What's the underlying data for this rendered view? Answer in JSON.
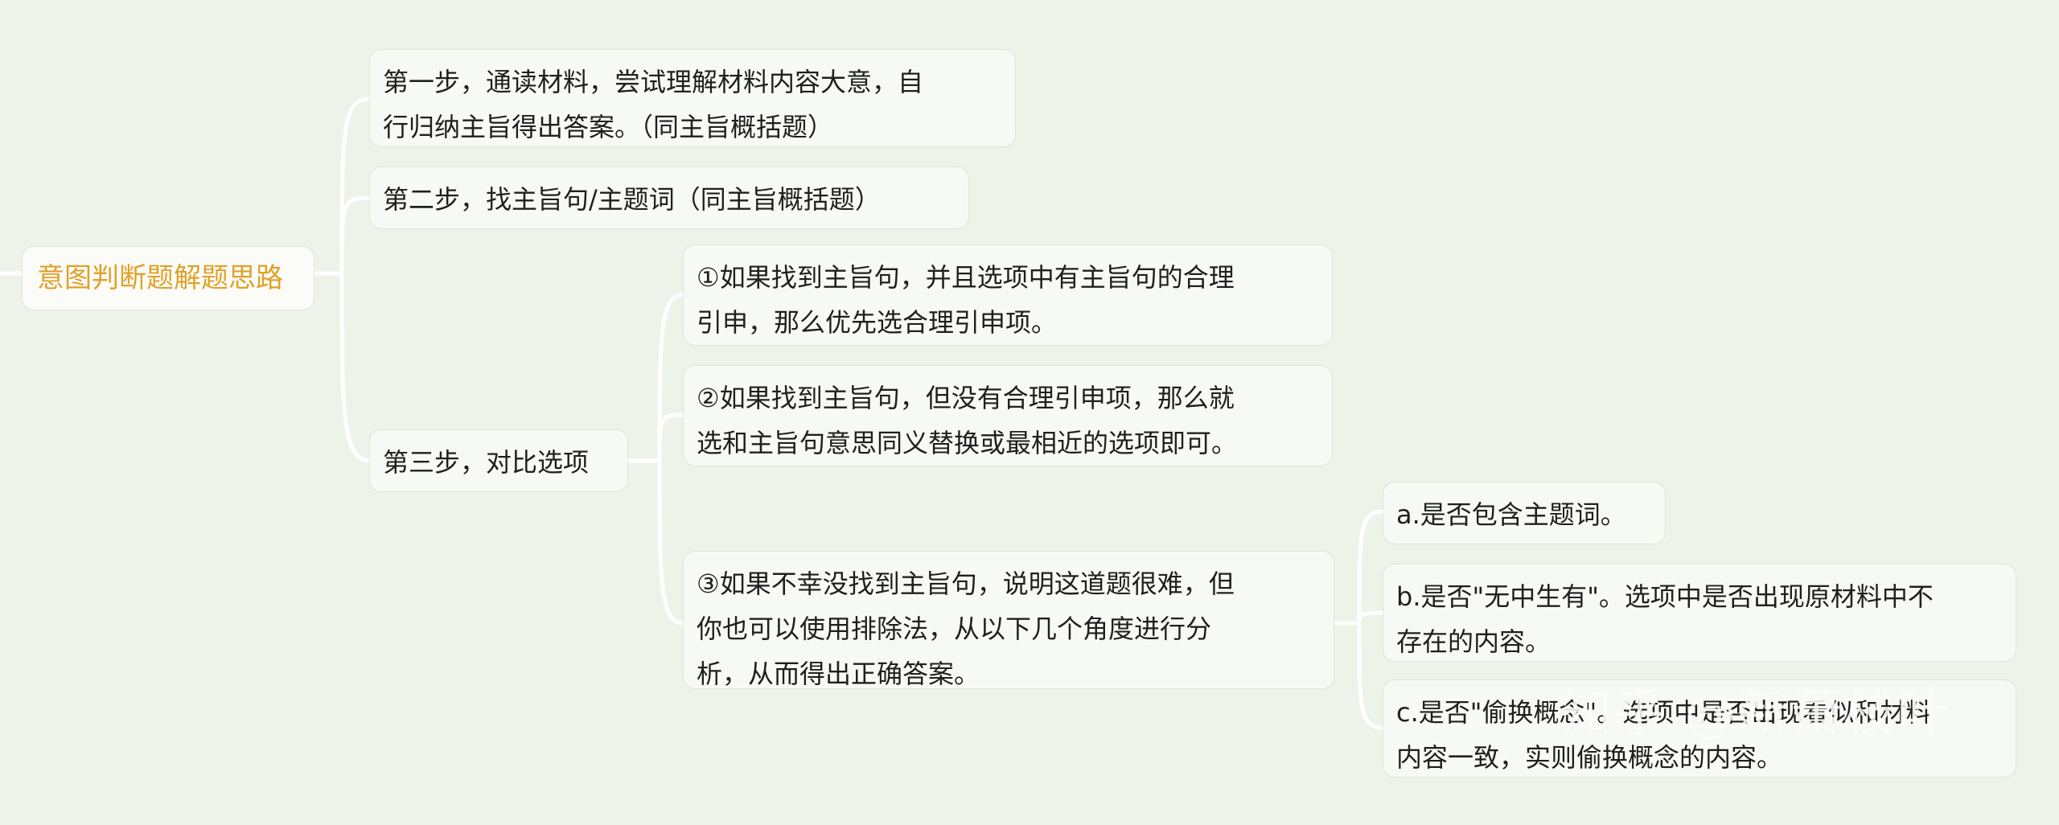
{
  "mindmap": {
    "root": {
      "label": "意图判断题解题思路"
    },
    "steps": [
      {
        "lines": [
          "第一步，通读材料，尝试理解材料内容大意，自",
          "行归纳主旨得出答案。（同主旨概括题）"
        ]
      },
      {
        "lines": [
          "第二步，找主旨句/主题词（同主旨概括题）"
        ]
      },
      {
        "lines": [
          "第三步，对比选项"
        ]
      }
    ],
    "step3_options": [
      {
        "lines": [
          "①如果找到主旨句，并且选项中有主旨句的合理",
          "引申，那么优先选合理引申项。"
        ]
      },
      {
        "lines": [
          "②如果找到主旨句，但没有合理引申项，那么就",
          "选和主旨句意思同义替换或最相近的选项即可。"
        ]
      },
      {
        "lines": [
          "③如果不幸没找到主旨句，说明这道题很难，但",
          "你也可以使用排除法，从以下几个角度进行分",
          "析，从而得出正确答案。"
        ]
      }
    ],
    "exclusion_checks": [
      {
        "lines": [
          "a.是否包含主题词。"
        ]
      },
      {
        "lines": [
          "b.是否\"无中生有\"。选项中是否出现原材料中不",
          "存在的内容。"
        ]
      },
      {
        "lines": [
          "c.是否\"偷换概念\"。选项中是否出现看似和材料",
          "内容一致，实则偷换概念的内容。"
        ]
      }
    ]
  },
  "watermark": {
    "text": "知乎 @新萧枝叶"
  },
  "colors": {
    "background": "#edf3e8",
    "node_bg": "#f7faf4",
    "root_text": "#e0a128",
    "text": "#1f1f1f",
    "connector": "#ffffff"
  }
}
